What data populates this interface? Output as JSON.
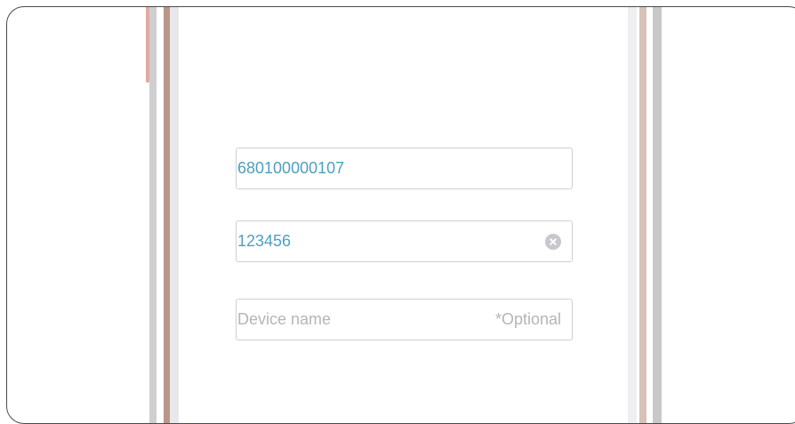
{
  "form": {
    "account_field": {
      "value": "680100000107"
    },
    "password_field": {
      "value": "123456",
      "clear_icon": "clear-circle-x"
    },
    "device_name_field": {
      "placeholder": "Device name",
      "hint": "*Optional"
    }
  },
  "colors": {
    "value_text": "#4f9fbf",
    "placeholder_text": "#b5b5ba",
    "field_border": "#cfcfd4",
    "device_frame_left": "#b9958a",
    "device_frame_right": "#d7c2b8",
    "side_button": "#dfaaa2"
  }
}
